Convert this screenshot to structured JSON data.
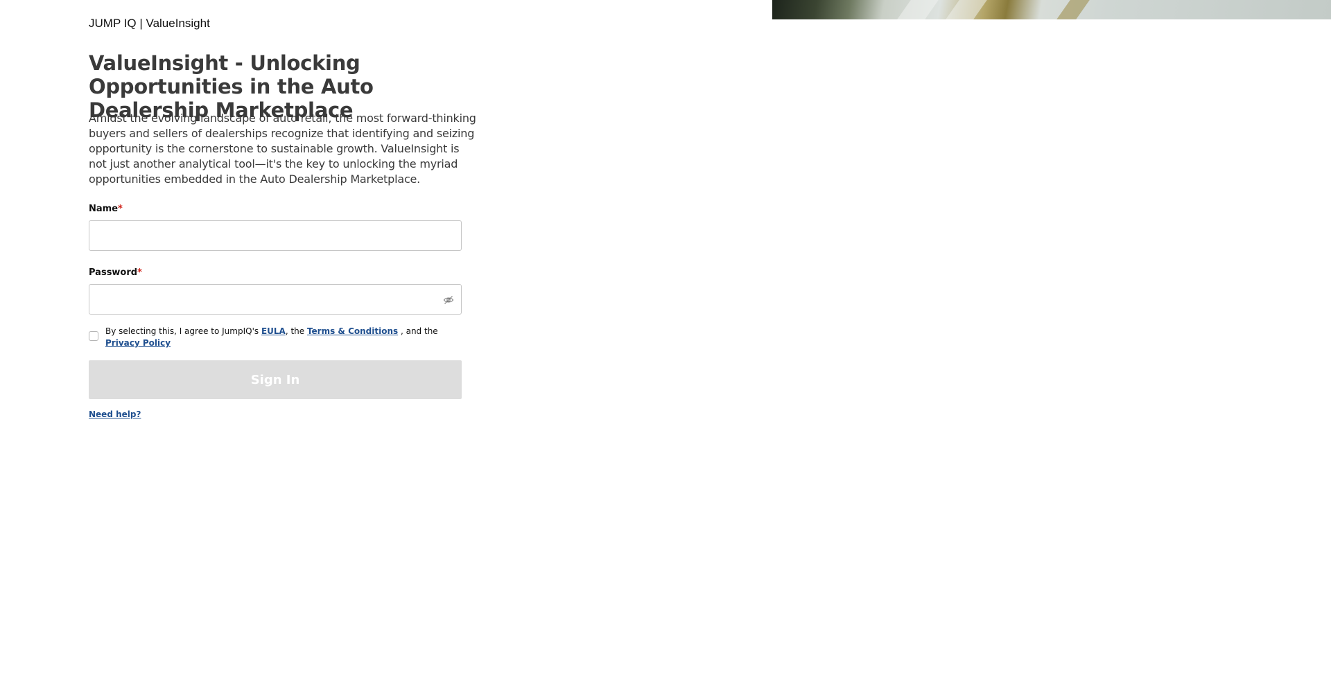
{
  "header": {
    "brand": "JUMP IQ | ValueInsight"
  },
  "main": {
    "title": "ValueInsight - Unlocking Opportunities in the Auto Dealership Marketplace",
    "description": "Amidst the evolving landscape of auto retail, the most forward-thinking buyers and sellers of dealerships recognize that identifying and seizing opportunity is the cornerstone to sustainable growth. ValueInsight is not just another analytical tool—it's the key to unlocking the myriad opportunities embedded in the Auto Dealership Marketplace."
  },
  "form": {
    "name_label": "Name",
    "name_value": "",
    "password_label": "Password",
    "password_value": "",
    "required_marker": "*",
    "password_toggle_icon": "eye-slash-icon",
    "consent": {
      "checked": false,
      "text_prefix": "By selecting this, I agree to JumpIQ's ",
      "eula_link": "EULA",
      "text_middle": ", the ",
      "terms_link": "Terms & Conditions",
      "text_and": " , and the ",
      "privacy_link": "Privacy Policy"
    },
    "submit_label": "Sign In",
    "help_link": "Need help?"
  },
  "colors": {
    "link": "#1f4f8f",
    "required": "#d0261d",
    "button_disabled_bg": "#dddddd"
  }
}
